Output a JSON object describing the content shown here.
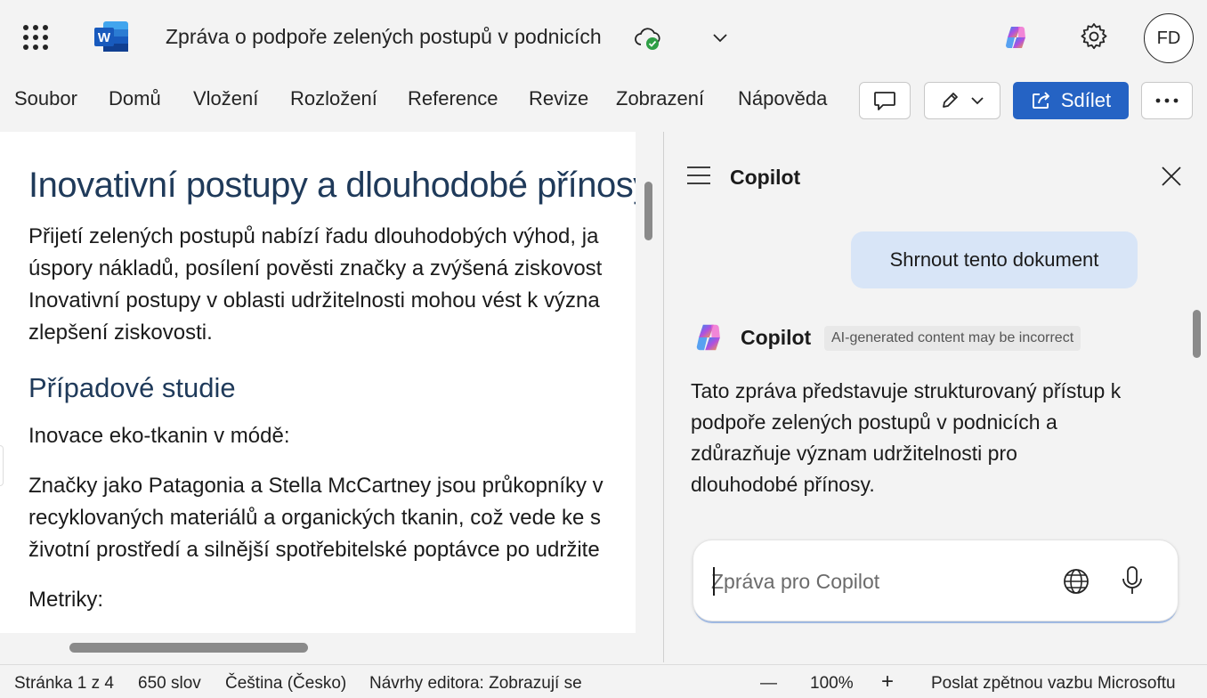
{
  "title_bar": {
    "document_title": "Zpráva o podpoře zelených postupů v podnicích",
    "avatar_initials": "FD",
    "icons": [
      "app-launcher-icon",
      "word-logo-icon",
      "cloud-saved-icon",
      "chevron-down-icon",
      "copilot-icon",
      "gear-icon"
    ]
  },
  "ribbon": {
    "tabs": [
      "Soubor",
      "Domů",
      "Vložení",
      "Rozložení",
      "Reference",
      "Revize",
      "Zobrazení",
      "Nápověda"
    ],
    "share_label": "Sdílet",
    "accent_color": "#2563c4"
  },
  "document": {
    "heading1": "Inovativní postupy a dlouhodobé přínosy",
    "para1": [
      "Přijetí zelených postupů nabízí řadu dlouhodobých výhod, ja",
      "úspory nákladů, posílení pověsti značky a zvýšená ziskovost",
      "Inovativní postupy v oblasti udržitelnosti mohou vést k význa",
      "zlepšení ziskovosti."
    ],
    "heading2": "Případové studie",
    "subhead": "Inovace eko-tkanin v módě:",
    "para2": [
      "Značky jako Patagonia a Stella McCartney jsou průkopníky v",
      "recyklovaných materiálů a organických tkanin, což vede ke s",
      "životní prostředí a silnější spotřebitelské poptávce po udržite"
    ],
    "metrics_label": "Metriky:"
  },
  "copilot": {
    "pane_title": "Copilot",
    "user_prompt": "Shrnout tento dokument",
    "responder_name": "Copilot",
    "ai_badge": "AI-generated content may be incorrect",
    "response_lines": [
      "Tato zpráva představuje strukturovaný přístup k",
      "podpoře zelených postupů v podnicích a",
      "zdůrazňuje význam udržitelnosti pro",
      "dlouhodobé přínosy."
    ],
    "compose_placeholder": "Zpráva pro Copilot"
  },
  "status_bar": {
    "page": "Stránka 1 z 4",
    "words": "650 slov",
    "language": "Čeština (Česko)",
    "editor": "Návrhy editora: Zobrazují se",
    "zoom_minus": "—",
    "zoom": "100%",
    "zoom_plus": "+",
    "feedback": "Poslat zpětnou vazbu Microsoftu"
  }
}
